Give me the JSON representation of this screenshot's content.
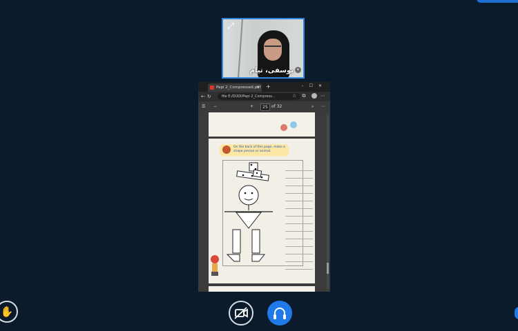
{
  "participant": {
    "name": "یوسفی، تیام"
  },
  "browser": {
    "tab_title": "Pepi 2_Compressed.pdf",
    "url": "file   E:/DUDI/Pepi 2_Compress...",
    "page_current": "25",
    "page_total": "of 32"
  },
  "pdf_page": {
    "instruction": "On the back of this page, make a shape person or animal."
  },
  "colors": {
    "background": "#0b1b2b",
    "accent": "#1f7ae8",
    "tile_border": "#2e86e0"
  },
  "icons": {
    "raise_hand": "hand-icon",
    "camera": "camera-off-icon",
    "audio": "headphones-icon",
    "tile_expand": "expand-icon"
  }
}
